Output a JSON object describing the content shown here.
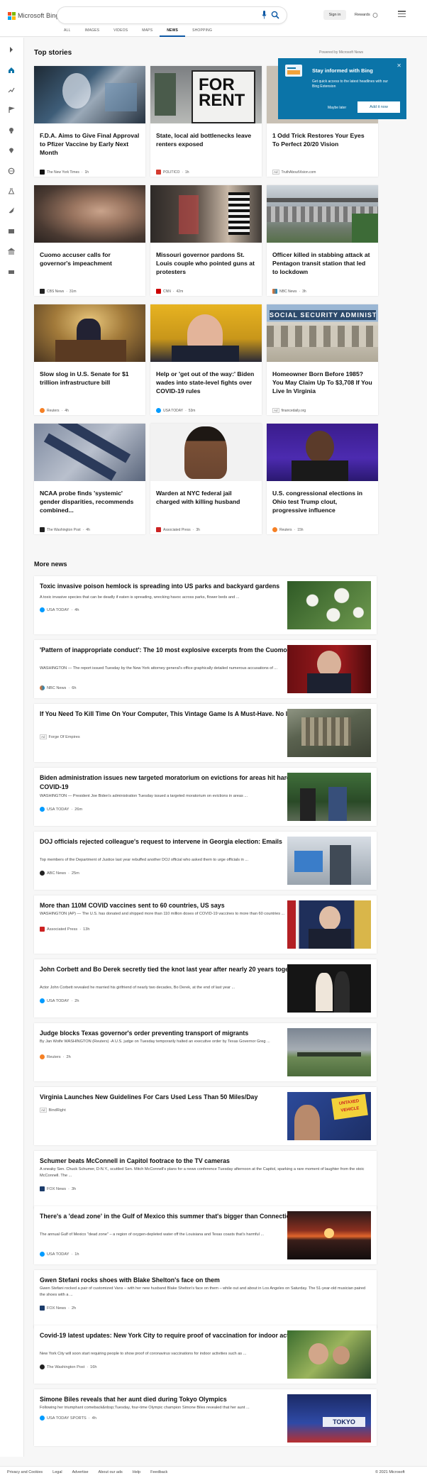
{
  "header": {
    "brand": "Microsoft Bing",
    "signin": "Sign in",
    "rewards": "Rewards",
    "rewards_count": "0",
    "tabs": [
      "ALL",
      "IMAGES",
      "VIDEOS",
      "MAPS",
      "NEWS",
      "SHOPPING"
    ],
    "active_tab": "NEWS"
  },
  "top_stories": {
    "heading": "Top stories",
    "powered": "Powered by Microsoft News",
    "cards": [
      {
        "title": "F.D.A. Aims to Give Final Approval to Pfizer Vaccine by Early Next Month",
        "source": "The New York Times",
        "time": "1h"
      },
      {
        "title": "State, local aid bottlenecks leave renters exposed",
        "source": "POLITICO",
        "time": "1h"
      },
      {
        "title": "1 Odd Trick Restores Your Eyes To Perfect 20/20 Vision",
        "ad": "Ad",
        "source": "TruthAboutVision.com",
        "time": ""
      },
      {
        "title": "Cuomo accuser calls for governor's impeachment",
        "source": "CBS News",
        "time": "31m"
      },
      {
        "title": "Missouri governor pardons St. Louis couple who pointed guns at protesters",
        "source": "CNN",
        "time": "42m"
      },
      {
        "title": "Officer killed in stabbing attack at Pentagon transit station that led to lockdown",
        "source": "NBC News",
        "time": "3h"
      },
      {
        "title": "Slow slog in U.S. Senate for $1 trillion infrastructure bill",
        "source": "Reuters",
        "time": "4h"
      },
      {
        "title": "Help or 'get out of the way:' Biden wades into state-level fights over COVID-19 rules",
        "source": "USA TODAY",
        "time": "53m"
      },
      {
        "title": "Homeowner Born Before 1985? You May Claim Up To $3,708 If You Live In Virginia",
        "ad": "Ad",
        "source": "financedaily.org",
        "time": ""
      },
      {
        "title": "NCAA probe finds 'systemic' gender disparities, recommends combined...",
        "source": "The Washington Post",
        "time": "4h"
      },
      {
        "title": "Warden at NYC federal jail charged with killing husband",
        "source": "Associated Press",
        "time": "3h"
      },
      {
        "title": "U.S. congressional elections in Ohio test Trump clout, progressive influence",
        "source": "Reuters",
        "time": "15h"
      }
    ]
  },
  "popup": {
    "title": "Stay informed with Bing",
    "text": "Get quick access to the latest headlines with our Bing Extension",
    "later": "Maybe later",
    "add": "Add it now"
  },
  "more_news": {
    "heading": "More news",
    "items": [
      {
        "title": "Toxic invasive poison hemlock is spreading into US parks and backyard gardens",
        "snippet": "A toxic invasive species that can be deadly if eaten is spreading, wrecking havoc across parks, flower beds and ...",
        "source": "USA TODAY",
        "time": "4h"
      },
      {
        "title": "'Pattern of inappropriate conduct': The 10 most explosive excerpts from the Cuomo report",
        "snippet": "WASHINGTON — The report issued Tuesday by the New York attorney general's office graphically detailed numerous accusations of ...",
        "source": "NBC News",
        "time": "6h"
      },
      {
        "title": "If You Need To Kill Time On Your Computer, This Vintage Game Is A Must-Have. No Install.",
        "snippet": "",
        "ad": "Ad",
        "source": "Forge Of Empires",
        "time": ""
      },
      {
        "title": "Biden administration issues new targeted moratorium on evictions for areas hit hardest by COVID-19",
        "snippet": "WASHINGTON — President Joe Biden's administration Tuesday issued a targeted moratorium on evictions in areas ...",
        "source": "USA TODAY",
        "time": "26m"
      },
      {
        "title": "DOJ officials rejected colleague's request to intervene in Georgia election: Emails",
        "snippet": "Top members of the Department of Justice last year rebuffed another DOJ official who asked them to urge officials in ...",
        "source": "ABC News",
        "time": "25m"
      },
      {
        "title": "More than 110M COVID vaccines sent to 60 countries, US says",
        "snippet": "WASHINGTON (AP) — The U.S. has donated and shipped more than 110 million doses of COVID-19 vaccines to more than 60 countries ...",
        "source": "Associated Press",
        "time": "13h"
      },
      {
        "title": "John Corbett and Bo Derek secretly tied the knot last year after nearly 20 years together",
        "snippet": "Actor John Corbett revealed he married his girlfriend of nearly two decades, Bo Derek, at the end of last year ...",
        "source": "USA TODAY",
        "time": "2h"
      },
      {
        "title": "Judge blocks Texas governor's order preventing transport of migrants",
        "snippet": "By Jan Wolfe WASHINGTON (Reuters) -A U.S. judge on Tuesday temporarily halted an executive order by Texas Governor Greg ...",
        "source": "Reuters",
        "time": "2h"
      },
      {
        "title": "Virginia Launches New Guidelines For Cars Used Less Than 50 Miles/Day",
        "snippet": "",
        "ad": "Ad",
        "source": "BindRight",
        "time": ""
      },
      {
        "title": "Schumer beats McConnell in Capitol footrace to the TV cameras",
        "snippet": "A sneaky Sen. Chuck Schumer, D-N.Y., scuttled Sen. Mitch McConnell's plans for a news conference Tuesday afternoon at the Capitol, sparking a rare moment of laughter from the stoic McConnell. The ...",
        "source": "FOX News",
        "time": "3h"
      },
      {
        "title": "There's a 'dead zone' in the Gulf of Mexico this summer that's bigger than Connecticut",
        "snippet": "The annual Gulf of Mexico \"dead zone\" – a region of oxygen-depleted water off the Louisiana and Texas coasts that's harmful ...",
        "source": "USA TODAY",
        "time": "1h"
      },
      {
        "title": "Gwen Stefani rocks shoes with Blake Shelton's face on them",
        "snippet": "Gwen Stefani rocked a pair of customized Vans – with her new husband Blake Shelton's face on them – while out and about in Los Angeles on Saturday. The 51-year-old musician paired the shoes with a ...",
        "source": "FOX News",
        "time": "2h"
      },
      {
        "title": "Covid-19 latest updates: New York City to require proof of vaccination for indoor activities",
        "snippet": "New York City will soon start requiring people to show proof of coronavirus vaccinations for indoor activities such as ...",
        "source": "The Washington Post",
        "time": "16h"
      },
      {
        "title": "Simone Biles reveals that her aunt died during Tokyo Olympics",
        "snippet": "Following her triumphant comeback&nbsp;Tuesday, four-time Olympic champion Simone Biles revealed that her aunt ...",
        "source": "USA TODAY SPORTS",
        "time": "4h"
      }
    ]
  },
  "footer": {
    "links": [
      "Privacy and Cookies",
      "Legal",
      "Advertise",
      "About our ads",
      "Help",
      "Feedback"
    ],
    "copyright": "© 2021 Microsoft"
  },
  "colors": {
    "accent": "#0b57a4",
    "popup": "#0b74a8"
  }
}
